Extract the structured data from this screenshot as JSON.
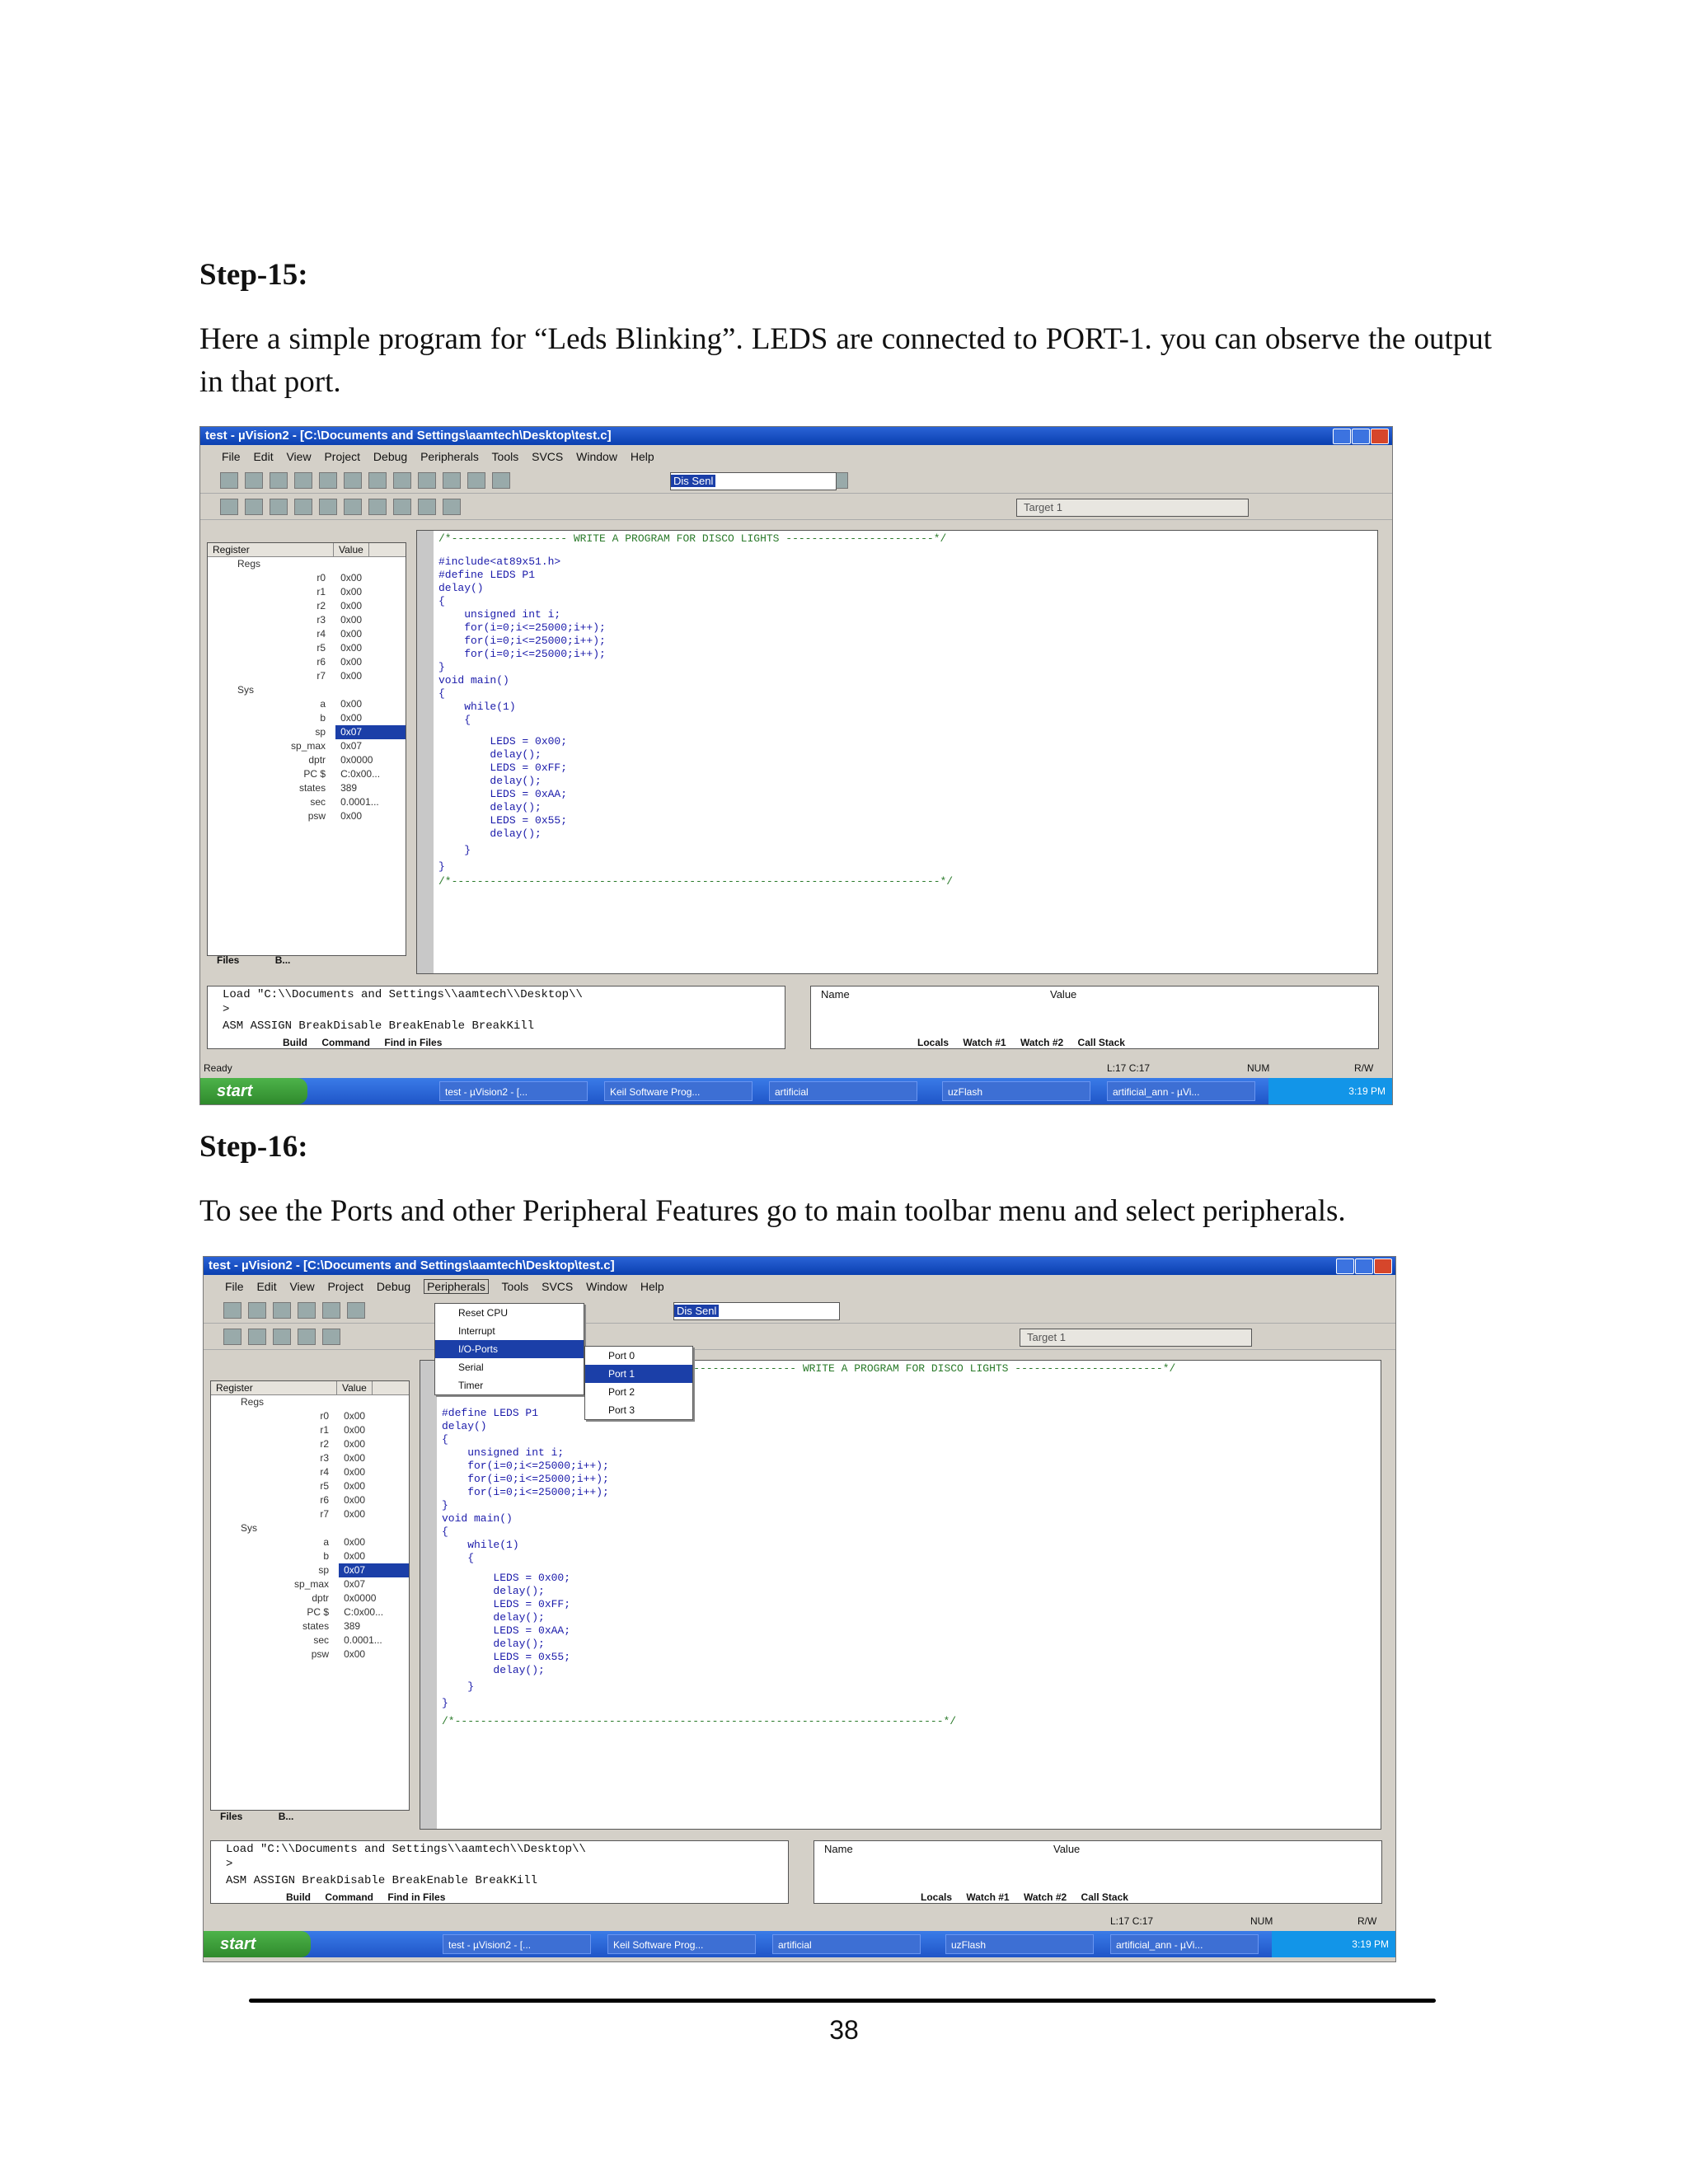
{
  "step15": {
    "heading": "Step-15:",
    "text": "Here a simple program for “Leds Blinking”. LEDS are connected to PORT-1. you can observe the output in that port."
  },
  "step16": {
    "heading": "Step-16:",
    "text": "To see the Ports and other Peripheral Features go to main toolbar menu and select peripherals."
  },
  "ide": {
    "title": "test - µVision2 - [C:\\Documents and Settings\\aamtech\\Desktop\\test.c]",
    "menus": [
      "File",
      "Edit",
      "View",
      "Project",
      "Debug",
      "Peripherals",
      "Tools",
      "SVCS",
      "Window",
      "Help"
    ],
    "combo_value": "Dis Senl",
    "target_value": "Target 1",
    "register_headers": [
      "Register",
      "Value"
    ],
    "registers": [
      {
        "name": "Regs",
        "value": "",
        "group": true
      },
      {
        "name": "r0",
        "value": "0x00"
      },
      {
        "name": "r1",
        "value": "0x00"
      },
      {
        "name": "r2",
        "value": "0x00"
      },
      {
        "name": "r3",
        "value": "0x00"
      },
      {
        "name": "r4",
        "value": "0x00"
      },
      {
        "name": "r5",
        "value": "0x00"
      },
      {
        "name": "r6",
        "value": "0x00"
      },
      {
        "name": "r7",
        "value": "0x00"
      },
      {
        "name": "Sys",
        "value": "",
        "group": true
      },
      {
        "name": "a",
        "value": "0x00"
      },
      {
        "name": "b",
        "value": "0x00"
      },
      {
        "name": "sp",
        "value": "0x07",
        "hl": true
      },
      {
        "name": "sp_max",
        "value": "0x07"
      },
      {
        "name": "dptr",
        "value": "0x0000"
      },
      {
        "name": "PC $",
        "value": "C:0x00..."
      },
      {
        "name": "states",
        "value": "389"
      },
      {
        "name": "sec",
        "value": "0.0001..."
      },
      {
        "name": "psw",
        "value": "0x00"
      }
    ],
    "code": [
      "/*------------------ WRITE A PROGRAM FOR DISCO LIGHTS -----------------------*/",
      "#include<at89x51.h>",
      "#define LEDS P1",
      "delay()",
      "{",
      "    unsigned int i;",
      "    for(i=0;i<=25000;i++);",
      "    for(i=0;i<=25000;i++);",
      "    for(i=0;i<=25000;i++);",
      "}",
      "void main()",
      "{",
      "    while(1)",
      "    {",
      "        LEDS = 0x00;",
      "        delay();",
      "        LEDS = 0xFF;",
      "        delay();",
      "        LEDS = 0xAA;",
      "        delay();",
      "        LEDS = 0x55;",
      "        delay();",
      "    }",
      "}",
      "/*----------------------------------------------------------------------------*/"
    ],
    "output_lines": [
      "Load \"C:\\\\Documents and Settings\\\\aamtech\\\\Desktop\\\\",
      ">",
      "ASM ASSIGN BreakDisable BreakEnable BreakKill"
    ],
    "output_tabs": [
      "Build",
      "Command",
      "Find in Files"
    ],
    "watch_headers": [
      "Name",
      "Value"
    ],
    "watch_tabs": [
      "Locals",
      "Watch #1",
      "Watch #2",
      "Call Stack"
    ],
    "project_tabs": [
      "Files",
      "B..."
    ],
    "status_ready": "Ready",
    "status_pos": "L:17 C:17",
    "status_num": "NUM",
    "status_rw": "R/W",
    "start_label": "start",
    "tasks": [
      "test - µVision2 - [...",
      "Keil Software Prog...",
      "artificial",
      "uzFlash",
      "artificial_ann - µVi..."
    ],
    "clock": "3:19 PM",
    "periph_menu": [
      "Reset CPU",
      "Interrupt",
      "I/O-Ports",
      "Serial",
      "Timer"
    ],
    "ports_menu": [
      "Port 0",
      "Port 1",
      "Port 2",
      "Port 3"
    ]
  },
  "page_number": "38"
}
